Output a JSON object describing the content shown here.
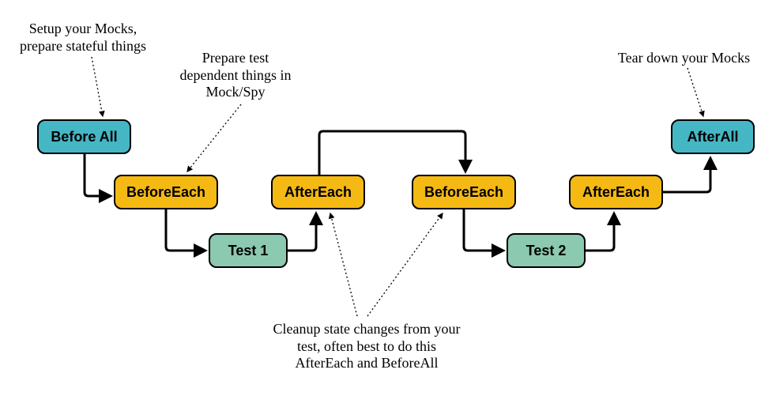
{
  "nodes": {
    "beforeAll": "Before All",
    "beforeEach1": "BeforeEach",
    "test1": "Test 1",
    "afterEach1": "AfterEach",
    "beforeEach2": "BeforeEach",
    "test2": "Test 2",
    "afterEach2": "AfterEach",
    "afterAll": "AfterAll"
  },
  "annotations": {
    "setup": "Setup your Mocks,\nprepare stateful things",
    "prepare": "Prepare test\ndependent things in\nMock/Spy",
    "cleanup": "Cleanup state changes from your\ntest, often best to do this\nAfterEach and BeforeAll",
    "teardown": "Tear down your Mocks"
  }
}
